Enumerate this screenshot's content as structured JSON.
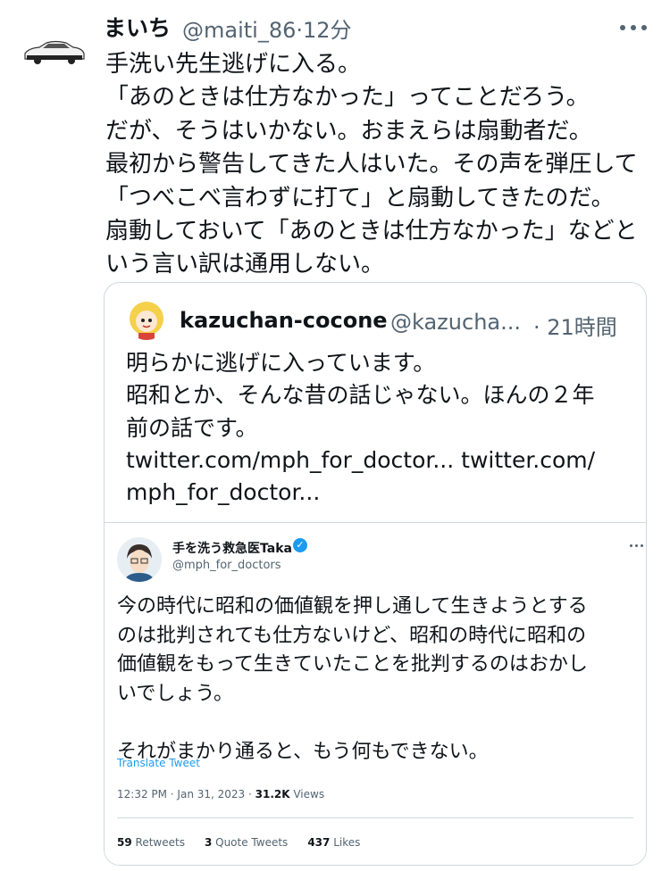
{
  "tweet": {
    "author_name": "まいち",
    "handle": "@maiti_86",
    "separator": "·",
    "time": "12分",
    "lines": [
      "手洗い先生逃げに入る。",
      "「あのときは仕方なかった」ってことだろう。",
      "だが、そうはいかない。おまえらは扇動者だ。",
      "最初から警告してきた人はいた。その声を弾圧して",
      "「つべこべ言わずに打て」と扇動してきたのだ。",
      "扇動しておいて「あのときは仕方なかった」などと",
      "いう言い訳は通用しない。"
    ]
  },
  "quoted": {
    "author_name": "kazuchan-cocone",
    "handle": "@kazucha...",
    "time": "· 21時間",
    "lines": [
      "明らかに逃げに入っています。",
      "昭和とか、そんな昔の話じゃない。ほんの２年",
      "前の話です。"
    ],
    "links": [
      "twitter.com/mph_for_doctor... twitter.com/",
      "mph_for_doctor..."
    ]
  },
  "embedded": {
    "author_name": "手を洗う救急医Taka",
    "verified_icon": "verified-badge-icon",
    "handle": "@mph_for_doctors",
    "lines": [
      "今の時代に昭和の価値観を押し通して生きようとする",
      "のは批判されても仕方ないけど、昭和の時代に昭和の",
      "価値観をもって生きていたことを批判するのはおかし",
      "いでしょう。",
      "",
      "それがまかり通ると、もう何もできない。"
    ],
    "translate": "Translate Tweet",
    "timestamp": "12:32 PM · Jan 31, 2023 · ",
    "views_count": "31.2K",
    "views_label": " Views",
    "retweets_count": "59",
    "retweets_label": " Retweets",
    "quotes_count": "3",
    "quotes_label": " Quote Tweets",
    "likes_count": "437",
    "likes_label": " Likes"
  },
  "colors": {
    "text": "#0f1419",
    "muted": "#536471",
    "accent": "#1d9bf0",
    "border": "#cfd9de"
  }
}
